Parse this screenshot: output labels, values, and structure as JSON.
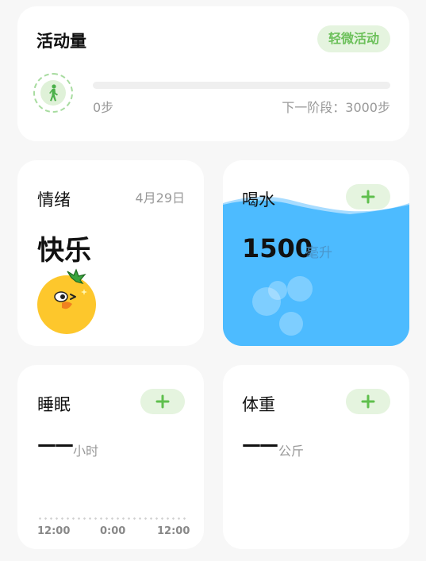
{
  "activity": {
    "title": "活动量",
    "badge": "轻微活动",
    "steps_current": "0步",
    "next_stage": "下一阶段：3000步",
    "progress_fraction": 0
  },
  "mood": {
    "title": "情绪",
    "date": "4月29日",
    "value": "快乐"
  },
  "water": {
    "title": "喝水",
    "value": "1500",
    "unit": "毫升",
    "color": "#4dbbff"
  },
  "sleep": {
    "title": "睡眠",
    "value": "——",
    "unit": "小时",
    "time_labels": [
      "12:00",
      "0:00",
      "12:00"
    ]
  },
  "weight": {
    "title": "体重",
    "value": "——",
    "unit": "公斤"
  },
  "colors": {
    "accent_green": "#6cc05a",
    "badge_bg": "#e5f4df"
  },
  "icons": {
    "activity": "walking-person-icon",
    "add": "plus-icon",
    "mood": "happy-face-icon"
  }
}
